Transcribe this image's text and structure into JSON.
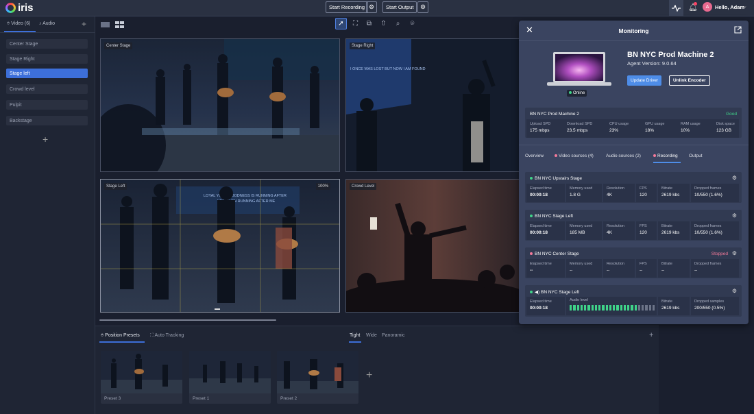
{
  "topbar": {
    "logo_text": "iris",
    "start_recording": "Start Recording",
    "start_output": "Start Output",
    "greeting": "Hello, Adam",
    "avatar_initial": "A"
  },
  "sidebar": {
    "tab_video": "Video (6)",
    "tab_audio": "Audio",
    "items": [
      "Center Stage",
      "Stage Right",
      "Stage left",
      "Crowd level",
      "Pulpit",
      "Backstage"
    ],
    "selected_index": 2
  },
  "feeds": {
    "f1": "Center Stage",
    "f2": "Stage Right",
    "f3": "Stage Left",
    "f3_zoom": "100%",
    "f4": "Crowd Level",
    "overlay_text_1": "LOYAL YOUR GOODNESS IS RUNNING AFTER",
    "overlay_text_2": "KEEPS ON RUNNING AFTER ME",
    "overlay_text_3": "I ONCE WAS LOST BUT NOW I AM FOUND"
  },
  "bottom": {
    "tab_presets": "Position Presets",
    "tab_tracking": "Auto Tracking",
    "zoom_tight": "Tight",
    "zoom_wide": "Wide",
    "zoom_panoramic": "Panoramic",
    "presets": [
      "Preset 3",
      "Preset 1",
      "Preset 2"
    ]
  },
  "monitoring": {
    "title": "Monitoring",
    "machine_name": "BN NYC Prod Machine 2",
    "agent_version": "Agent Version: 9.0.64",
    "status": "Online",
    "update_driver": "Update Driver",
    "unlink_encoder": "Unlink Encoder",
    "health": {
      "name": "BN NYC Prod Machine 2",
      "state": "Good",
      "metrics": [
        {
          "label": "Upload SPD",
          "value": "175 mbps"
        },
        {
          "label": "Download SPD",
          "value": "23.5 mbps"
        },
        {
          "label": "CPU usage",
          "value": "23%"
        },
        {
          "label": "GPU usage",
          "value": "18%"
        },
        {
          "label": "RAM usage",
          "value": "10%"
        },
        {
          "label": "Disk space",
          "value": "123 GB"
        }
      ]
    },
    "tabs": [
      "Overview",
      "Video sources (4)",
      "Audio sources (2)",
      "Recording",
      "Output"
    ],
    "active_tab": "Recording",
    "recordings": [
      {
        "name": "BN NYC Upstairs Stage",
        "dot": "#3fd489",
        "status": "",
        "elapsed": "00:00:18",
        "memory": "1.8 G",
        "resolution": "4K",
        "fps": "120",
        "bitrate": "2619 kbs",
        "dropped": "10/550 (1.6%)"
      },
      {
        "name": "BN NYC Stage Left",
        "dot": "#3fd489",
        "status": "",
        "elapsed": "00:00:18",
        "memory": "185 MB",
        "resolution": "4K",
        "fps": "120",
        "bitrate": "2619 kbs",
        "dropped": "10/550 (1.6%)"
      },
      {
        "name": "BN NYC Center Stage",
        "dot": "#f47a9a",
        "status": "Stopped",
        "elapsed": "--",
        "memory": "--",
        "resolution": "--",
        "fps": "--",
        "bitrate": "--",
        "dropped": "--"
      }
    ],
    "labels": {
      "elapsed": "Elapsed time",
      "memory": "Memory used",
      "resolution": "Resolution",
      "fps": "FPS",
      "bitrate": "Bitrate",
      "dropped": "Dropped frames",
      "audio_level": "Audio level",
      "dropped_samples": "Dropped samples"
    },
    "audio_recording": {
      "name": "BN NYC Stage Left",
      "elapsed": "00:00:18",
      "audio_level_fraction": 0.8,
      "bitrate": "2619 kbs",
      "dropped_samples": "200/550 (0.5%)"
    },
    "colors": {
      "good": "#3fd489",
      "stopped": "#f47a9a",
      "accent": "#4e8de8"
    }
  }
}
